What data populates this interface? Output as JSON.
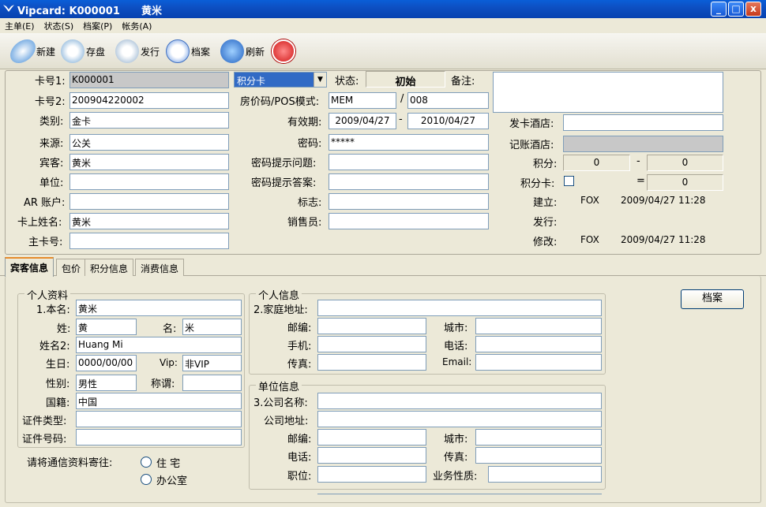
{
  "window": {
    "title": "Vipcard: K000001      黄米",
    "minimize": "_",
    "maximize": "□",
    "close": "x"
  },
  "menu": [
    "主单(E)",
    "状态(S)",
    "档案(P)",
    "帐务(A)"
  ],
  "toolbar": {
    "new": "新建",
    "save": "存盘",
    "issue": "发行",
    "archive": "档案",
    "refresh": "刷新"
  },
  "card": {
    "card1_label": "卡号1:",
    "card1": "K000001",
    "card2_label": "卡号2:",
    "card2": "200904220002",
    "type_label": "类别:",
    "type": "金卡",
    "source_label": "来源:",
    "source": "公关",
    "guest_label": "宾客:",
    "guest": "黄米",
    "unit_label": "单位:",
    "unit": "",
    "ar_label": "AR 账户:",
    "ar": "",
    "cardname_label": "卡上姓名:",
    "cardname": "黄米",
    "maincard_label": "主卡号:",
    "maincard": "",
    "cardkind": "积分卡",
    "status_label": "状态:",
    "status": "初始",
    "remark_label": "备注:",
    "remark": "",
    "rate_label": "房价码/POS模式:",
    "rate": "MEM",
    "slash": "/",
    "pos": "008",
    "valid_label": "有效期:",
    "valid_from": "2009/04/27",
    "dash": "-",
    "valid_to": "2010/04/27",
    "pwd_label": "密码:",
    "pwd": "*****",
    "q_label": "密码提示问题:",
    "q": "",
    "a_label": "密码提示答案:",
    "a": "",
    "flag_label": "标志:",
    "flag": "",
    "sales_label": "销售员:",
    "sales": "",
    "issue_hotel_label": "发卡酒店:",
    "issue_hotel": "",
    "acct_hotel_label": "记账酒店:",
    "acct_hotel": "",
    "points_label": "积分:",
    "points_a": "0",
    "points_dash": "-",
    "points_b": "0",
    "pcard_label": "积分卡:",
    "pcard_eq": "=",
    "pcard_val": "0",
    "created_label": "建立:",
    "created_by": "FOX",
    "created_at": "2009/04/27 11:28",
    "issued_label": "发行:",
    "modified_label": "修改:",
    "modified_by": "FOX",
    "modified_at": "2009/04/27 11:28"
  },
  "tabs": [
    "宾客信息",
    "包价",
    "积分信息",
    "消费信息"
  ],
  "personal": {
    "group": "个人资料",
    "name_label": "1.本名:",
    "name": "黄米",
    "last_label": "姓:",
    "last": "黄",
    "first_label": "名:",
    "first": "米",
    "name2_label": "姓名2:",
    "name2": "Huang Mi",
    "birth_label": "生日:",
    "birth": "0000/00/00",
    "vip_label": "Vip:",
    "vip": "非VIP",
    "sex_label": "性别:",
    "sex": "男性",
    "title_label": "称谓:",
    "title": "",
    "nation_label": "国籍:",
    "nation": "中国",
    "idtype_label": "证件类型:",
    "idtype": "",
    "idno_label": "证件号码:",
    "idno": "",
    "mail_label": "请将通信资料寄往:",
    "mail_home": "住  宅",
    "mail_office": "办公室"
  },
  "info": {
    "group": "个人信息",
    "home_label": "2.家庭地址:",
    "home": "",
    "zip_label": "邮编:",
    "city_label": "城市:",
    "mobile_label": "手机:",
    "phone_label": "电话:",
    "fax_label": "传真:",
    "email_label": "Email:"
  },
  "company": {
    "group": "单位信息",
    "name_label": "3.公司名称:",
    "addr_label": "公司地址:",
    "zip_label": "邮编:",
    "city_label": "城市:",
    "phone_label": "电话:",
    "fax_label": "传真:",
    "pos_label": "职位:",
    "biz_label": "业务性质:"
  },
  "archive_btn": "档案"
}
